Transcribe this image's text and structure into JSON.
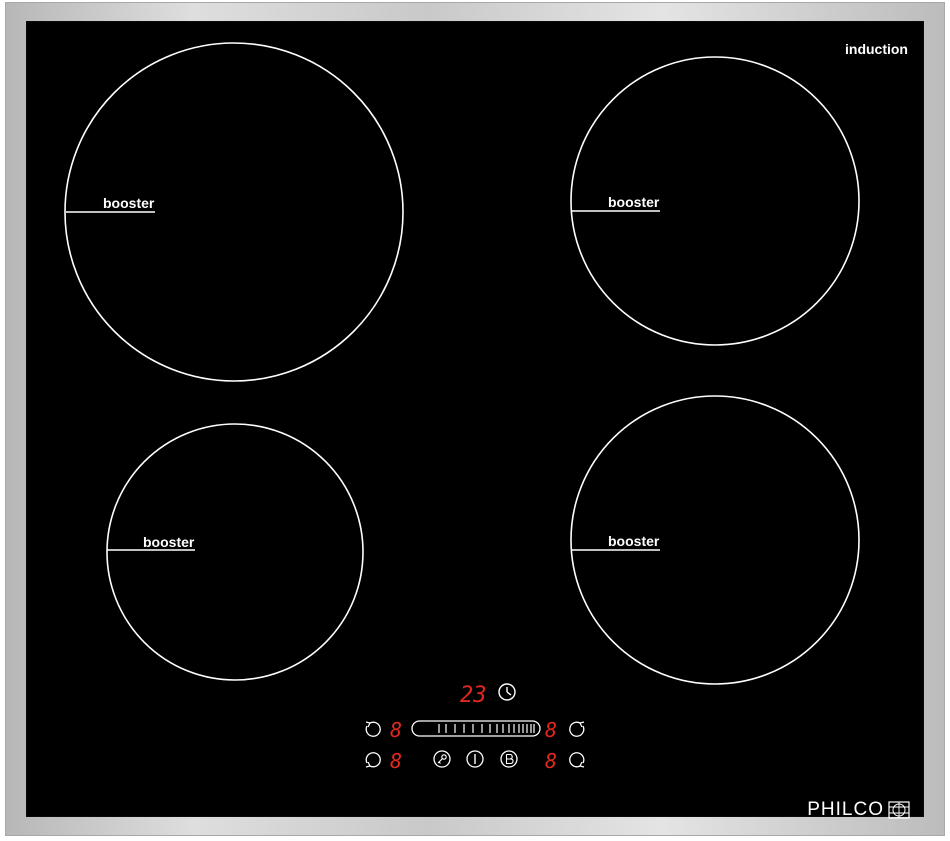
{
  "brand_label": "induction",
  "logo_text": "PHILCO",
  "zones": [
    {
      "id": "front-left-large",
      "label": "booster"
    },
    {
      "id": "rear-right",
      "label": "booster"
    },
    {
      "id": "front-left-small",
      "label": "booster"
    },
    {
      "id": "front-right",
      "label": "booster"
    }
  ],
  "display": {
    "timer_value": "23",
    "zone_level_top_left": "8",
    "zone_level_top_right": "8",
    "zone_level_bottom_left": "8",
    "zone_level_bottom_right": "8"
  },
  "colors": {
    "glass": "#000000",
    "frame": "#cfcfcf",
    "led": "#e0281e",
    "lines": "#ffffff"
  },
  "icons": [
    "clock-icon",
    "zone-select-icon",
    "lock-key-icon",
    "power-icon",
    "booster-b-icon",
    "slider-control"
  ]
}
